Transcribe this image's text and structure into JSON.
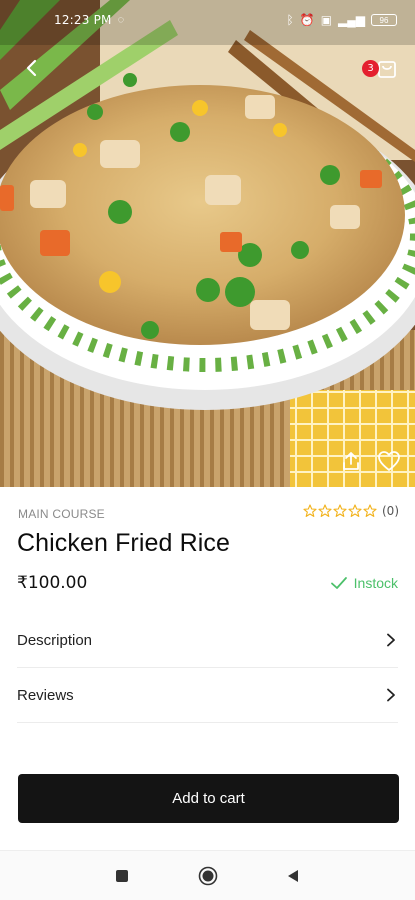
{
  "status_bar": {
    "time": "12:23 PM",
    "battery": "96"
  },
  "hero": {
    "image": "chicken-fried-rice-photo",
    "cart_count": "3"
  },
  "product": {
    "category": "MAIN COURSE",
    "title": "Chicken Fried Rice",
    "price": "₹100.00",
    "stock_status": "Instock",
    "rating_stars": 0,
    "rating_max": 5,
    "rating_count": "(0)"
  },
  "sections": [
    {
      "label": "Description"
    },
    {
      "label": "Reviews"
    }
  ],
  "actions": {
    "add_to_cart": "Add to cart"
  },
  "colors": {
    "accent_dark": "#141414",
    "stock_green": "#4cc06a",
    "badge_red": "#e4202f",
    "star_yellow": "#f2b21b"
  },
  "icons": {
    "back": "arrow-left-icon",
    "cart": "shopping-bag-icon",
    "share": "share-icon",
    "favorite": "heart-icon",
    "check": "check-icon",
    "chevron": "chevron-right-icon"
  }
}
